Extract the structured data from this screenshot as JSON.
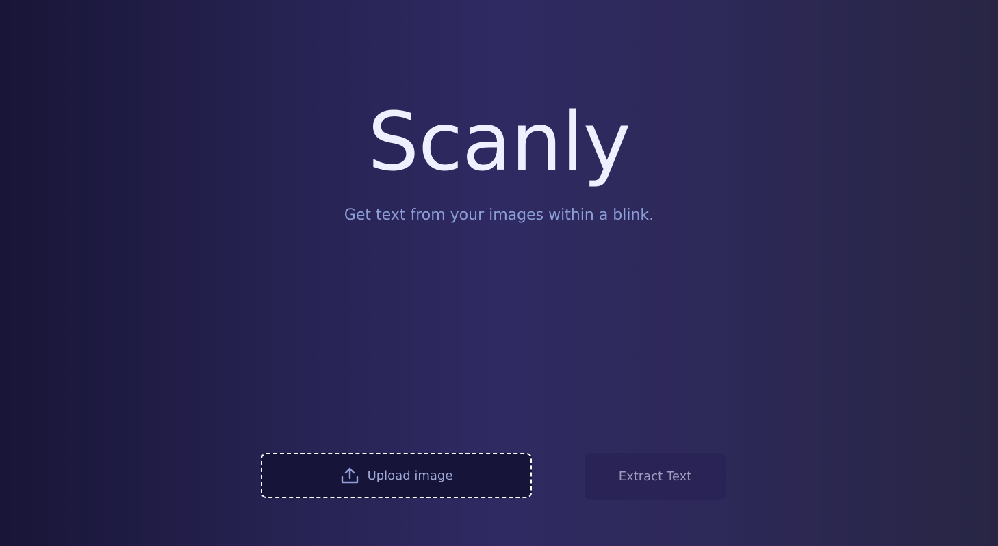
{
  "header": {
    "title": "Scanly",
    "subtitle": "Get text from your images within a blink."
  },
  "actions": {
    "upload": {
      "label": "Upload image",
      "icon": "upload-icon"
    },
    "extract": {
      "label": "Extract Text"
    }
  },
  "colors": {
    "title": "#eef0ff",
    "subtitle": "#8d9ed6",
    "upload_bg": "#17143a",
    "extract_bg": "#2a2356"
  }
}
